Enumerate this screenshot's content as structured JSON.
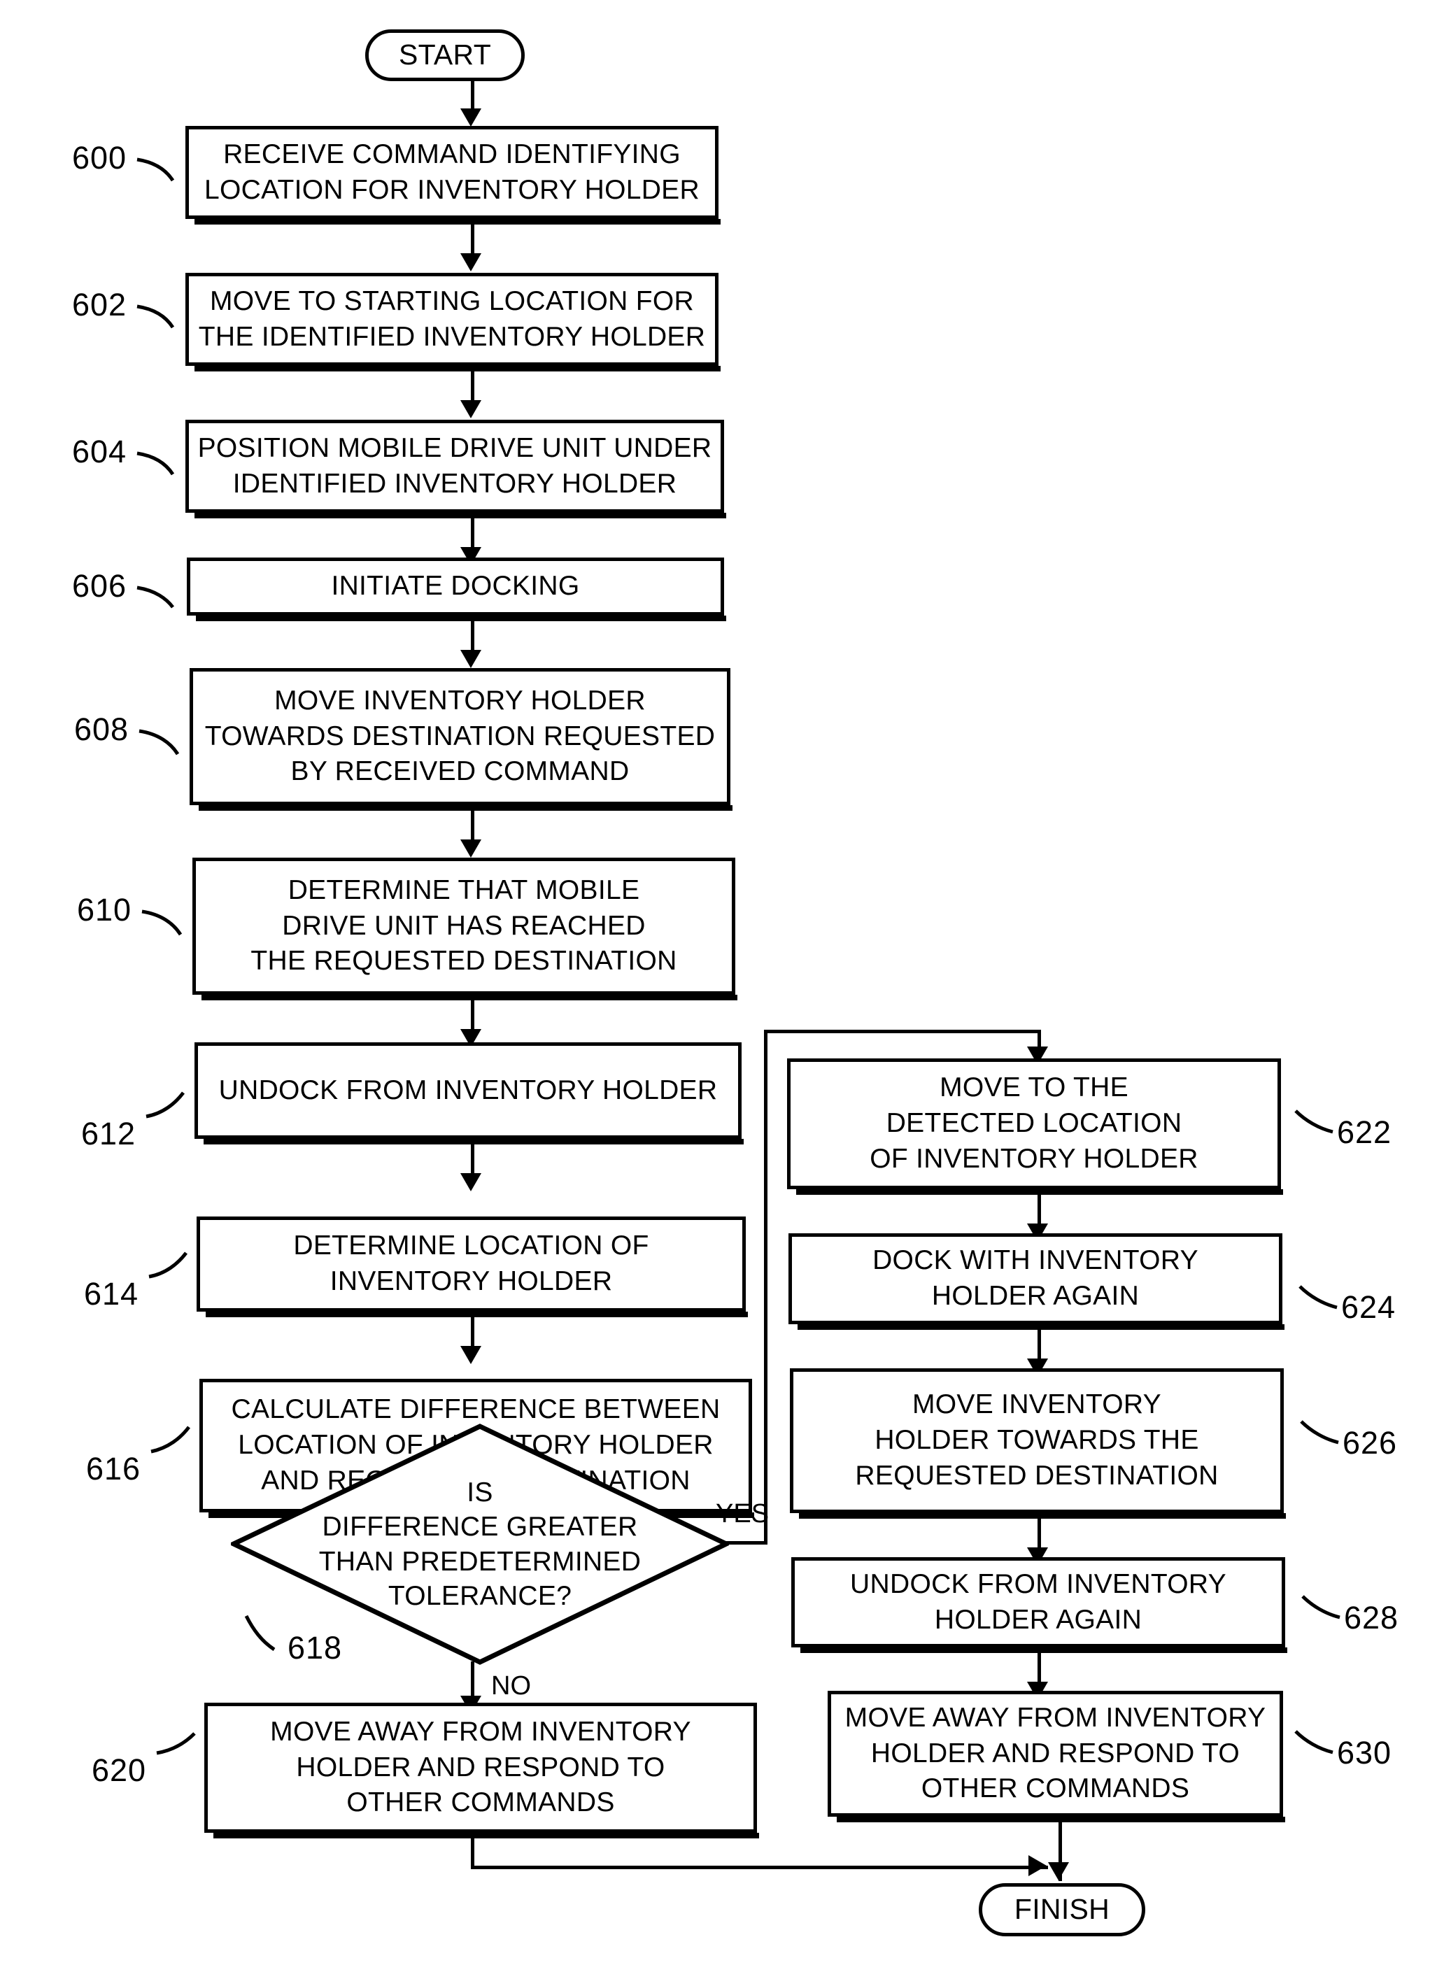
{
  "flowchart": {
    "title": "START",
    "nodes": {
      "start": {
        "ref": "",
        "text": "START",
        "shape": "terminal"
      },
      "n600": {
        "ref": "600",
        "shape": "process",
        "lines": [
          "RECEIVE COMMAND IDENTIFYING",
          "LOCATION FOR INVENTORY HOLDER"
        ]
      },
      "n602": {
        "ref": "602",
        "shape": "process",
        "lines": [
          "MOVE TO STARTING LOCATION FOR",
          "THE IDENTIFIED INVENTORY HOLDER"
        ]
      },
      "n604": {
        "ref": "604",
        "shape": "process",
        "lines": [
          "POSITION MOBILE DRIVE UNIT UNDER",
          "IDENTIFIED INVENTORY HOLDER"
        ]
      },
      "n606": {
        "ref": "606",
        "shape": "process",
        "lines": [
          "INITIATE DOCKING"
        ]
      },
      "n608": {
        "ref": "608",
        "shape": "process",
        "lines": [
          "MOVE INVENTORY HOLDER",
          "TOWARDS DESTINATION REQUESTED",
          "BY RECEIVED COMMAND"
        ]
      },
      "n610": {
        "ref": "610",
        "shape": "process",
        "lines": [
          "DETERMINE THAT MOBILE",
          "DRIVE UNIT HAS REACHED",
          "THE REQUESTED DESTINATION"
        ]
      },
      "n612": {
        "ref": "612",
        "shape": "process",
        "lines": [
          "UNDOCK FROM INVENTORY HOLDER"
        ]
      },
      "n614": {
        "ref": "614",
        "shape": "process",
        "lines": [
          "DETERMINE LOCATION OF",
          "INVENTORY HOLDER"
        ]
      },
      "n616": {
        "ref": "616",
        "shape": "process",
        "lines": [
          "CALCULATE DIFFERENCE BETWEEN",
          "LOCATION OF INVENTORY HOLDER",
          "AND REQUESTED DESTINATION"
        ]
      },
      "n618": {
        "ref": "618",
        "shape": "decision",
        "lines": [
          "IS",
          "DIFFERENCE GREATER",
          "THAN PREDETERMINED",
          "TOLERANCE?"
        ]
      },
      "n620": {
        "ref": "620",
        "shape": "process",
        "lines": [
          "MOVE AWAY FROM INVENTORY",
          "HOLDER AND RESPOND TO",
          "OTHER COMMANDS"
        ]
      },
      "n622": {
        "ref": "622",
        "shape": "process",
        "lines": [
          "MOVE TO THE",
          "DETECTED LOCATION",
          "OF INVENTORY HOLDER"
        ]
      },
      "n624": {
        "ref": "624",
        "shape": "process",
        "lines": [
          "DOCK WITH INVENTORY",
          "HOLDER AGAIN"
        ]
      },
      "n626": {
        "ref": "626",
        "shape": "process",
        "lines": [
          "MOVE INVENTORY",
          "HOLDER TOWARDS THE",
          "REQUESTED DESTINATION"
        ]
      },
      "n628": {
        "ref": "628",
        "shape": "process",
        "lines": [
          "UNDOCK FROM INVENTORY",
          "HOLDER AGAIN"
        ]
      },
      "n630": {
        "ref": "630",
        "shape": "process",
        "lines": [
          "MOVE AWAY FROM INVENTORY",
          "HOLDER AND RESPOND TO",
          "OTHER COMMANDS"
        ]
      },
      "finish": {
        "ref": "",
        "text": "FINISH",
        "shape": "terminal"
      }
    },
    "edges": {
      "yes_label": "YES",
      "no_label": "NO",
      "sequence": [
        "START -> 600",
        "600 -> 602",
        "602 -> 604",
        "604 -> 606",
        "606 -> 608",
        "608 -> 610",
        "610 -> 612",
        "612 -> 614",
        "614 -> 616",
        "616 -> 618",
        "618 -YES-> 622",
        "618 -NO-> 620",
        "622 -> 624",
        "624 -> 626",
        "626 -> 628",
        "628 -> 630",
        "630 -> FINISH",
        "620 -> FINISH"
      ]
    },
    "colors": {
      "ink": "#000000",
      "paper": "#ffffff"
    }
  }
}
